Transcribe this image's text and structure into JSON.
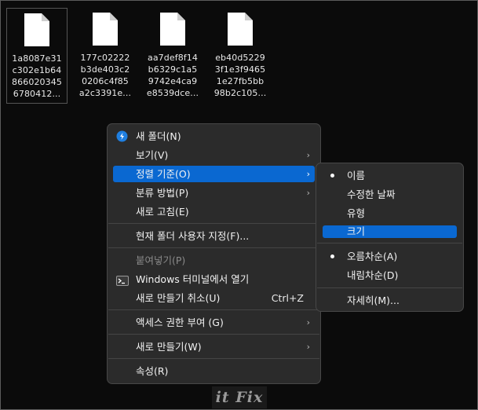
{
  "files": [
    {
      "name_lines": [
        "1a8087e31",
        "c302e1b64",
        "866020345",
        "6780412..."
      ],
      "selected": true
    },
    {
      "name_lines": [
        "177c02222",
        "b3de403c2",
        "0206c4f85",
        "a2c3391e..."
      ],
      "selected": false
    },
    {
      "name_lines": [
        "aa7def8f14",
        "b6329c1a5",
        "9742e4ca9",
        "e8539dce..."
      ],
      "selected": false
    },
    {
      "name_lines": [
        "eb40d5229",
        "3f1e3f9465",
        "1e27fb5bb",
        "98b2c105..."
      ],
      "selected": false
    }
  ],
  "context_menu": {
    "new_folder": "새 폴더(N)",
    "view": "보기(V)",
    "sort_by": "정렬 기준(O)",
    "group_by": "분류 방법(P)",
    "refresh": "새로 고침(E)",
    "customize_folder": "현재 폴더 사용자 지정(F)...",
    "paste": "붙여넣기(P)",
    "open_terminal": "Windows 터미널에서 열기",
    "undo_new": "새로 만들기 취소(U)",
    "undo_shortcut": "Ctrl+Z",
    "give_access": "액세스 권한 부여 (G)",
    "new": "새로 만들기(W)",
    "properties": "속성(R)"
  },
  "sort_submenu": {
    "name": "이름",
    "date_modified": "수정한 날짜",
    "type": "유형",
    "size": "크기",
    "ascending": "오름차순(A)",
    "descending": "내림차순(D)",
    "more": "자세히(M)..."
  },
  "watermark": "it Fix",
  "colors": {
    "highlight": "#0a68d1",
    "menu_bg": "#2b2b2b",
    "background": "#0b0b0b"
  }
}
